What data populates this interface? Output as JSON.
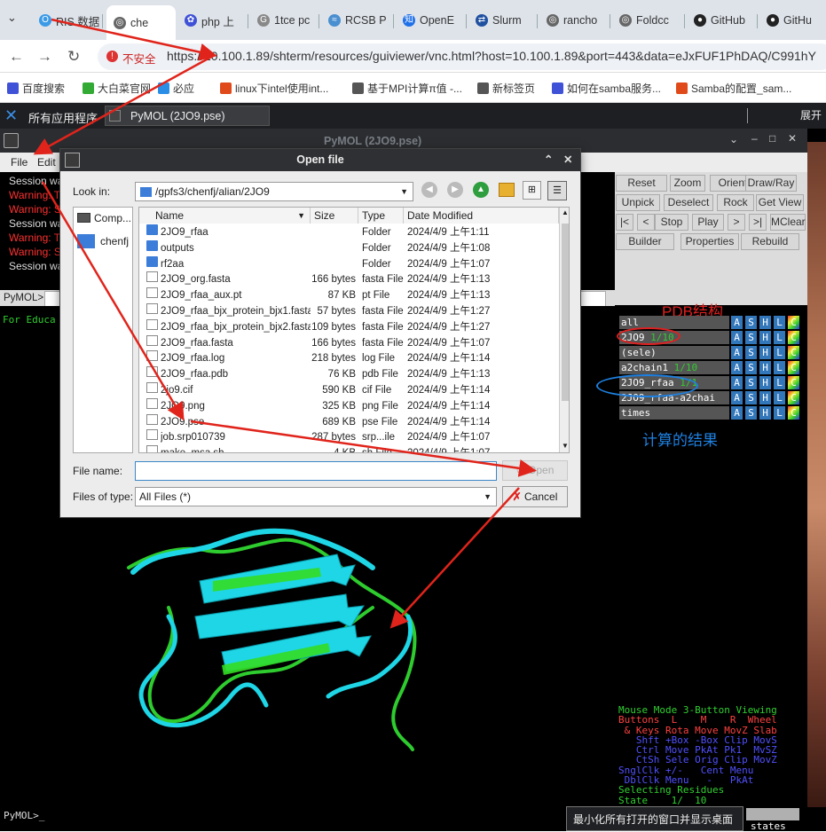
{
  "browser": {
    "tabs": [
      {
        "label": "RIS 数据",
        "icon": "loading-icon"
      },
      {
        "label": "che",
        "icon": "globe-icon"
      },
      {
        "label": "php 上",
        "icon": "paw-icon"
      },
      {
        "label": "1tce pc",
        "icon": "google-icon"
      },
      {
        "label": "RCSB P",
        "icon": "rcsb-icon"
      },
      {
        "label": "OpenE",
        "icon": "zhihu-icon"
      },
      {
        "label": "Slurm",
        "icon": "slurm-icon"
      },
      {
        "label": "rancho",
        "icon": "globe-icon"
      },
      {
        "label": "Foldcc",
        "icon": "globe-icon"
      },
      {
        "label": "GitHub",
        "icon": "github-icon"
      },
      {
        "label": "GitHu",
        "icon": "github-icon"
      }
    ],
    "security_label": "不安全",
    "url": "https://10.100.1.89/shterm/resources/guiviewer/vnc.html?host=10.100.1.89&port=443&data=eJxFUF1PhDAQ/C991hY",
    "bookmarks": [
      "百度搜索",
      "大白菜官网",
      "必应",
      "linux下intel使用int...",
      "基于MPI计算π值 -...",
      "新标签页",
      "如何在samba服务...",
      "Samba的配置_sam..."
    ]
  },
  "desktop": {
    "app_menu": "所有应用程序",
    "task_item": "PyMOL (2JO9.pse)",
    "expand_label": "展开"
  },
  "pymol": {
    "title": "PyMOL (2JO9.pse)",
    "menu": [
      "File",
      "Edit"
    ],
    "log": [
      {
        "text": "Session wa",
        "color": "#dddddd"
      },
      {
        "text": "Warning: Th",
        "color": "#ff3030"
      },
      {
        "text": "Warning: Sc",
        "color": "#ff3030"
      },
      {
        "text": "Session wa",
        "color": "#dddddd"
      },
      {
        "text": "Warning: Th",
        "color": "#ff3030"
      },
      {
        "text": "Warning: Sc",
        "color": "#ff3030"
      },
      {
        "text": "Session wa",
        "color": "#dddddd"
      }
    ],
    "prompt": "PyMOL>",
    "edu_text": "For Educa",
    "buttons": [
      [
        "Reset",
        "Zoom",
        "Orient",
        "Draw/Ray"
      ],
      [
        "Unpick",
        "Deselect",
        "Rock",
        "Get View"
      ],
      [
        "|<",
        "<",
        "Stop",
        "Play",
        ">",
        ">|",
        "MClear"
      ],
      [
        "Builder",
        "Properties",
        "Rebuild"
      ]
    ],
    "objects": [
      {
        "name": "all",
        "count": ""
      },
      {
        "name": "2JO9",
        "count": "1/10"
      },
      {
        "name": "(sele)",
        "count": ""
      },
      {
        "name": "a2chain1",
        "count": "1/10"
      },
      {
        "name": "2JO9_rfaa",
        "count": "1/1"
      },
      {
        "name": "2JO9_rfaa-a2chai",
        "count": ""
      },
      {
        "name": "times",
        "count": ""
      }
    ],
    "obj_letters": [
      "A",
      "S",
      "H",
      "L",
      "C"
    ],
    "annot_pdb": "PDB结构",
    "annot_result": "计算的结果",
    "mouse_lines": [
      {
        "text": "Mouse Mode 3-Button Viewing",
        "color": "#30d030"
      },
      {
        "text": "Buttons  L    M    R  Wheel",
        "color": "#ff4040"
      },
      {
        "text": " & Keys Rota Move MovZ Slab",
        "color": "#ff4040"
      },
      {
        "text": "   Shft +Box -Box Clip MovS",
        "color": "#5050ff"
      },
      {
        "text": "   Ctrl Move PkAt Pk1  MvSZ",
        "color": "#5050ff"
      },
      {
        "text": "   CtSh Sele Orig Clip MovZ",
        "color": "#5050ff"
      },
      {
        "text": "SnglClk +/-   Cent Menu",
        "color": "#5050ff"
      },
      {
        "text": " DblClk Menu   -   PkAt",
        "color": "#5050ff"
      },
      {
        "text": "Selecting Residues",
        "color": "#30d030"
      },
      {
        "text": "State    1/  10",
        "color": "#30d030"
      }
    ],
    "bottom_prompt": "PyMOL>_",
    "tooltip": "最小化所有打开的窗口并显示桌面",
    "states_label": "states"
  },
  "dialog": {
    "title": "Open file",
    "look_in_label": "Look in:",
    "look_in_value": "/gpfs3/chenfj/alian/2JO9",
    "sidebar": [
      "Comp...",
      "chenfj"
    ],
    "columns": [
      "Name",
      "Size",
      "Type",
      "Date Modified"
    ],
    "files": [
      {
        "name": "2JO9_rfaa",
        "size": "",
        "type": "Folder",
        "date": "2024/4/9 上午1:11",
        "kind": "folder"
      },
      {
        "name": "outputs",
        "size": "",
        "type": "Folder",
        "date": "2024/4/9 上午1:08",
        "kind": "folder"
      },
      {
        "name": "rf2aa",
        "size": "",
        "type": "Folder",
        "date": "2024/4/9 上午1:07",
        "kind": "folder"
      },
      {
        "name": "2JO9_org.fasta",
        "size": "166 bytes",
        "type": "fasta File",
        "date": "2024/4/9 上午1:13",
        "kind": "file"
      },
      {
        "name": "2JO9_rfaa_aux.pt",
        "size": "87 KB",
        "type": "pt File",
        "date": "2024/4/9 上午1:13",
        "kind": "file"
      },
      {
        "name": "2JO9_rfaa_bjx_protein_bjx1.fasta",
        "size": "57 bytes",
        "type": "fasta File",
        "date": "2024/4/9 上午1:27",
        "kind": "file"
      },
      {
        "name": "2JO9_rfaa_bjx_protein_bjx2.fasta",
        "size": "109 bytes",
        "type": "fasta File",
        "date": "2024/4/9 上午1:27",
        "kind": "file"
      },
      {
        "name": "2JO9_rfaa.fasta",
        "size": "166 bytes",
        "type": "fasta File",
        "date": "2024/4/9 上午1:07",
        "kind": "file"
      },
      {
        "name": "2JO9_rfaa.log",
        "size": "218 bytes",
        "type": "log File",
        "date": "2024/4/9 上午1:14",
        "kind": "file"
      },
      {
        "name": "2JO9_rfaa.pdb",
        "size": "76 KB",
        "type": "pdb File",
        "date": "2024/4/9 上午1:13",
        "kind": "file"
      },
      {
        "name": "2jo9.cif",
        "size": "590 KB",
        "type": "cif File",
        "date": "2024/4/9 上午1:14",
        "kind": "file"
      },
      {
        "name": "2JO9.png",
        "size": "325 KB",
        "type": "png File",
        "date": "2024/4/9 上午1:14",
        "kind": "file"
      },
      {
        "name": "2JO9.pse",
        "size": "689 KB",
        "type": "pse File",
        "date": "2024/4/9 上午1:14",
        "kind": "file"
      },
      {
        "name": "job.srp010739",
        "size": "287 bytes",
        "type": "srp...ile",
        "date": "2024/4/9 上午1:07",
        "kind": "file"
      },
      {
        "name": "make_msa.sh",
        "size": "4 KB",
        "type": "sh File",
        "date": "2024/4/9 上午1:07",
        "kind": "file"
      }
    ],
    "filename_label": "File name:",
    "filename_value": "",
    "filetype_label": "Files of type:",
    "filetype_value": "All Files (*)",
    "open_label": "Open",
    "cancel_label": "Cancel"
  }
}
